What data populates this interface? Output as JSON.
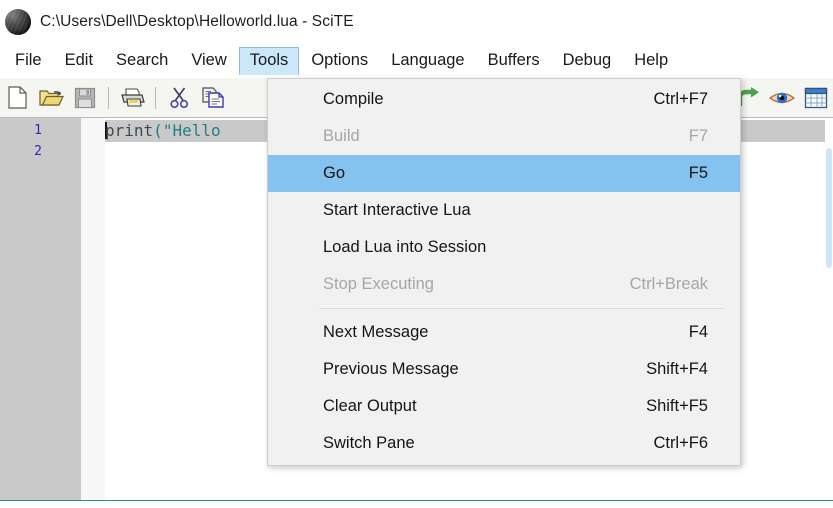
{
  "window": {
    "title": "C:\\Users\\Dell\\Desktop\\Helloworld.lua - SciTE",
    "app_icon": "scite-ball-icon"
  },
  "menubar": {
    "items": [
      {
        "label": "File",
        "open": false
      },
      {
        "label": "Edit",
        "open": false
      },
      {
        "label": "Search",
        "open": false
      },
      {
        "label": "View",
        "open": false
      },
      {
        "label": "Tools",
        "open": true
      },
      {
        "label": "Options",
        "open": false
      },
      {
        "label": "Language",
        "open": false
      },
      {
        "label": "Buffers",
        "open": false
      },
      {
        "label": "Debug",
        "open": false
      },
      {
        "label": "Help",
        "open": false
      }
    ]
  },
  "toolbar": {
    "buttons": [
      {
        "name": "new-file-icon",
        "enabled": true
      },
      {
        "name": "open-file-icon",
        "enabled": true
      },
      {
        "name": "save-file-icon",
        "enabled": false
      },
      {
        "name": "separator",
        "enabled": false
      },
      {
        "name": "print-icon",
        "enabled": true
      },
      {
        "name": "separator",
        "enabled": false
      },
      {
        "name": "cut-icon",
        "enabled": true
      },
      {
        "name": "copy-icon",
        "enabled": true
      },
      {
        "name": "redo-icon",
        "enabled": true
      },
      {
        "name": "eye-icon",
        "enabled": true
      },
      {
        "name": "grid-icon",
        "enabled": true
      }
    ]
  },
  "editor": {
    "line_numbers": [
      "1",
      "2"
    ],
    "code": {
      "fn": "print",
      "open_paren": "(",
      "string_start": "\"Hello"
    },
    "current_line": 1,
    "caret_column": 1
  },
  "tools_menu": {
    "items": [
      {
        "label": "Compile",
        "accel": "Ctrl+F7",
        "state": "normal"
      },
      {
        "label": "Build",
        "accel": "F7",
        "state": "disabled"
      },
      {
        "label": "Go",
        "accel": "F5",
        "state": "selected"
      },
      {
        "label": "Start Interactive Lua",
        "accel": "",
        "state": "normal"
      },
      {
        "label": "Load Lua into Session",
        "accel": "",
        "state": "normal"
      },
      {
        "label": "Stop Executing",
        "accel": "Ctrl+Break",
        "state": "disabled"
      },
      {
        "label": "__separator__",
        "accel": "",
        "state": "separator"
      },
      {
        "label": "Next Message",
        "accel": "F4",
        "state": "normal"
      },
      {
        "label": "Previous Message",
        "accel": "Shift+F4",
        "state": "normal"
      },
      {
        "label": "Clear Output",
        "accel": "Shift+F5",
        "state": "normal"
      },
      {
        "label": "Switch Pane",
        "accel": "Ctrl+F6",
        "state": "normal"
      }
    ]
  },
  "colors": {
    "menu_highlight": "#84c3f0",
    "menubar_open": "#cce6fa",
    "gutter": "#c9c9c9",
    "line_number": "#3c22b8",
    "string_token": "#1f7f86",
    "splitter": "#2f8a7e"
  }
}
